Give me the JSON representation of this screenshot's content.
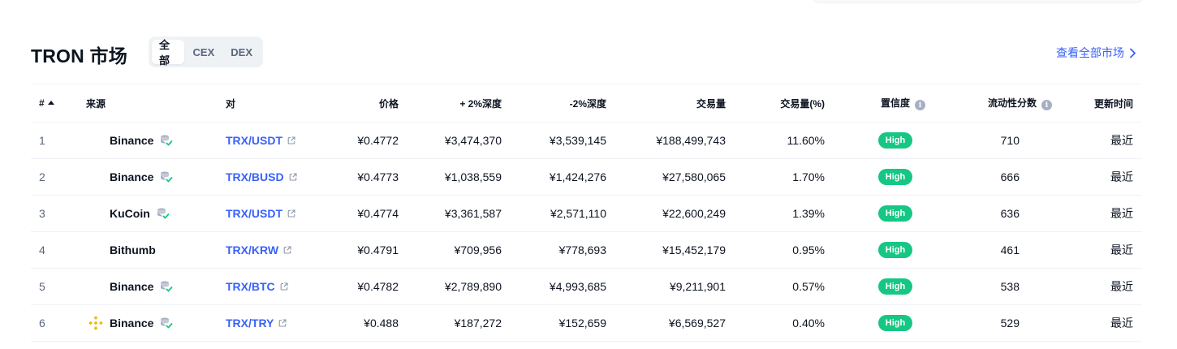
{
  "header": {
    "title": "TRON 市场",
    "segments": [
      "全部",
      "CEX",
      "DEX"
    ],
    "view_all": "查看全部市场"
  },
  "table": {
    "columns": {
      "rank": "#",
      "source": "来源",
      "pair": "对",
      "price": "价格",
      "plus_depth": "+ 2%深度",
      "minus_depth": "-2%深度",
      "volume": "交易量",
      "volume_pct": "交易量(%)",
      "confidence": "置信度",
      "liquidity": "流动性分数",
      "updated": "更新时间"
    },
    "rows": [
      {
        "rank": "1",
        "source": "Binance",
        "pair": "TRX/USDT",
        "price": "¥0.4772",
        "plus_depth": "¥3,474,370",
        "minus_depth": "¥3,539,145",
        "volume": "¥188,499,743",
        "volume_pct": "11.60%",
        "confidence": "High",
        "liquidity": "710",
        "updated": "最近"
      },
      {
        "rank": "2",
        "source": "Binance",
        "pair": "TRX/BUSD",
        "price": "¥0.4773",
        "plus_depth": "¥1,038,559",
        "minus_depth": "¥1,424,276",
        "volume": "¥27,580,065",
        "volume_pct": "1.70%",
        "confidence": "High",
        "liquidity": "666",
        "updated": "最近"
      },
      {
        "rank": "3",
        "source": "KuCoin",
        "pair": "TRX/USDT",
        "price": "¥0.4774",
        "plus_depth": "¥3,361,587",
        "minus_depth": "¥2,571,110",
        "volume": "¥22,600,249",
        "volume_pct": "1.39%",
        "confidence": "High",
        "liquidity": "636",
        "updated": "最近"
      },
      {
        "rank": "4",
        "source": "Bithumb",
        "pair": "TRX/KRW",
        "price": "¥0.4791",
        "plus_depth": "¥709,956",
        "minus_depth": "¥778,693",
        "volume": "¥15,452,179",
        "volume_pct": "0.95%",
        "confidence": "High",
        "liquidity": "461",
        "updated": "最近"
      },
      {
        "rank": "5",
        "source": "Binance",
        "pair": "TRX/BTC",
        "price": "¥0.4782",
        "plus_depth": "¥2,789,890",
        "minus_depth": "¥4,993,685",
        "volume": "¥9,211,901",
        "volume_pct": "0.57%",
        "confidence": "High",
        "liquidity": "538",
        "updated": "最近"
      },
      {
        "rank": "6",
        "source": "Binance",
        "pair": "TRX/TRY",
        "price": "¥0.488",
        "plus_depth": "¥187,272",
        "minus_depth": "¥152,659",
        "volume": "¥6,569,527",
        "volume_pct": "0.40%",
        "confidence": "High",
        "liquidity": "529",
        "updated": "最近"
      }
    ]
  },
  "colors": {
    "accent": "#3861fb",
    "high_badge": "#16c784",
    "binance_logo": "#f0b90b",
    "verified": "#16c784"
  },
  "icons": {
    "sort": "sort-asc-icon",
    "info": "info-icon",
    "verified": "verified-reserve-icon",
    "external": "external-link-icon",
    "chevron": "chevron-right-icon",
    "logo": "binance-logo-icon"
  }
}
